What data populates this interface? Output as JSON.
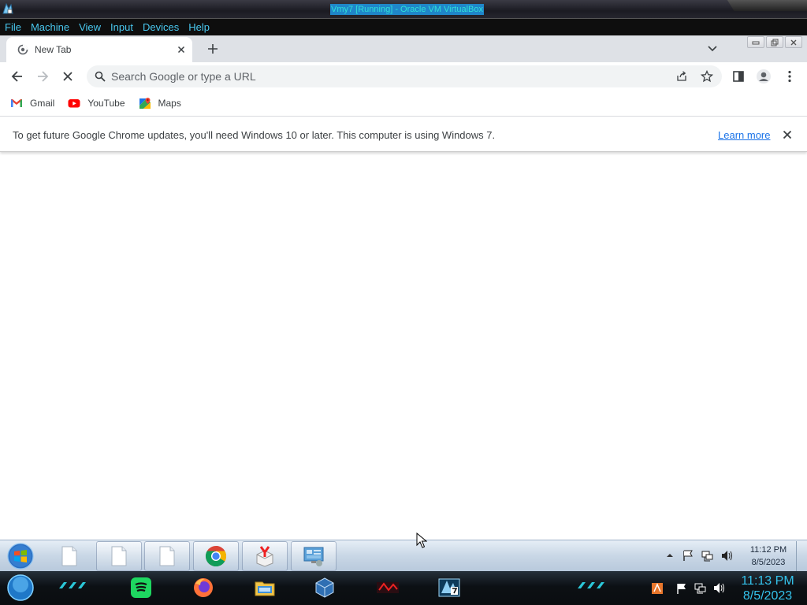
{
  "vbox": {
    "window_title": "Vmy7 [Running] - Oracle VM VirtualBox",
    "menu": [
      "File",
      "Machine",
      "View",
      "Input",
      "Devices",
      "Help"
    ]
  },
  "chrome": {
    "tab": {
      "title": "New Tab"
    },
    "omnibox": {
      "placeholder": "Search Google or type a URL",
      "value": ""
    },
    "bookmarks": [
      {
        "label": "Gmail",
        "icon": "gmail-icon"
      },
      {
        "label": "YouTube",
        "icon": "youtube-icon"
      },
      {
        "label": "Maps",
        "icon": "maps-icon"
      }
    ],
    "infobar": {
      "message": "To get future Google Chrome updates, you'll need Windows 10 or later. This computer is using Windows 7.",
      "link": "Learn more"
    }
  },
  "guest_taskbar": {
    "time": "11:12 PM",
    "date": "8/5/2023",
    "items": [
      "blank-file-icon",
      "blank-file-icon",
      "blank-file-icon",
      "chrome-icon",
      "yandex-icon",
      "control-panel-icon"
    ]
  },
  "host_taskbar": {
    "time": "11:13 PM",
    "date": "8/5/2023",
    "items": [
      "spotify-icon",
      "firefox-icon",
      "file-explorer-icon",
      "virtualbox-icon",
      "game-icon",
      "vm-icon"
    ]
  },
  "colors": {
    "vbox_menu_text": "#49c7ee",
    "chrome_tabstrip": "#dee1e6",
    "link_blue": "#1a73e8",
    "host_clock": "#34c3ec"
  }
}
